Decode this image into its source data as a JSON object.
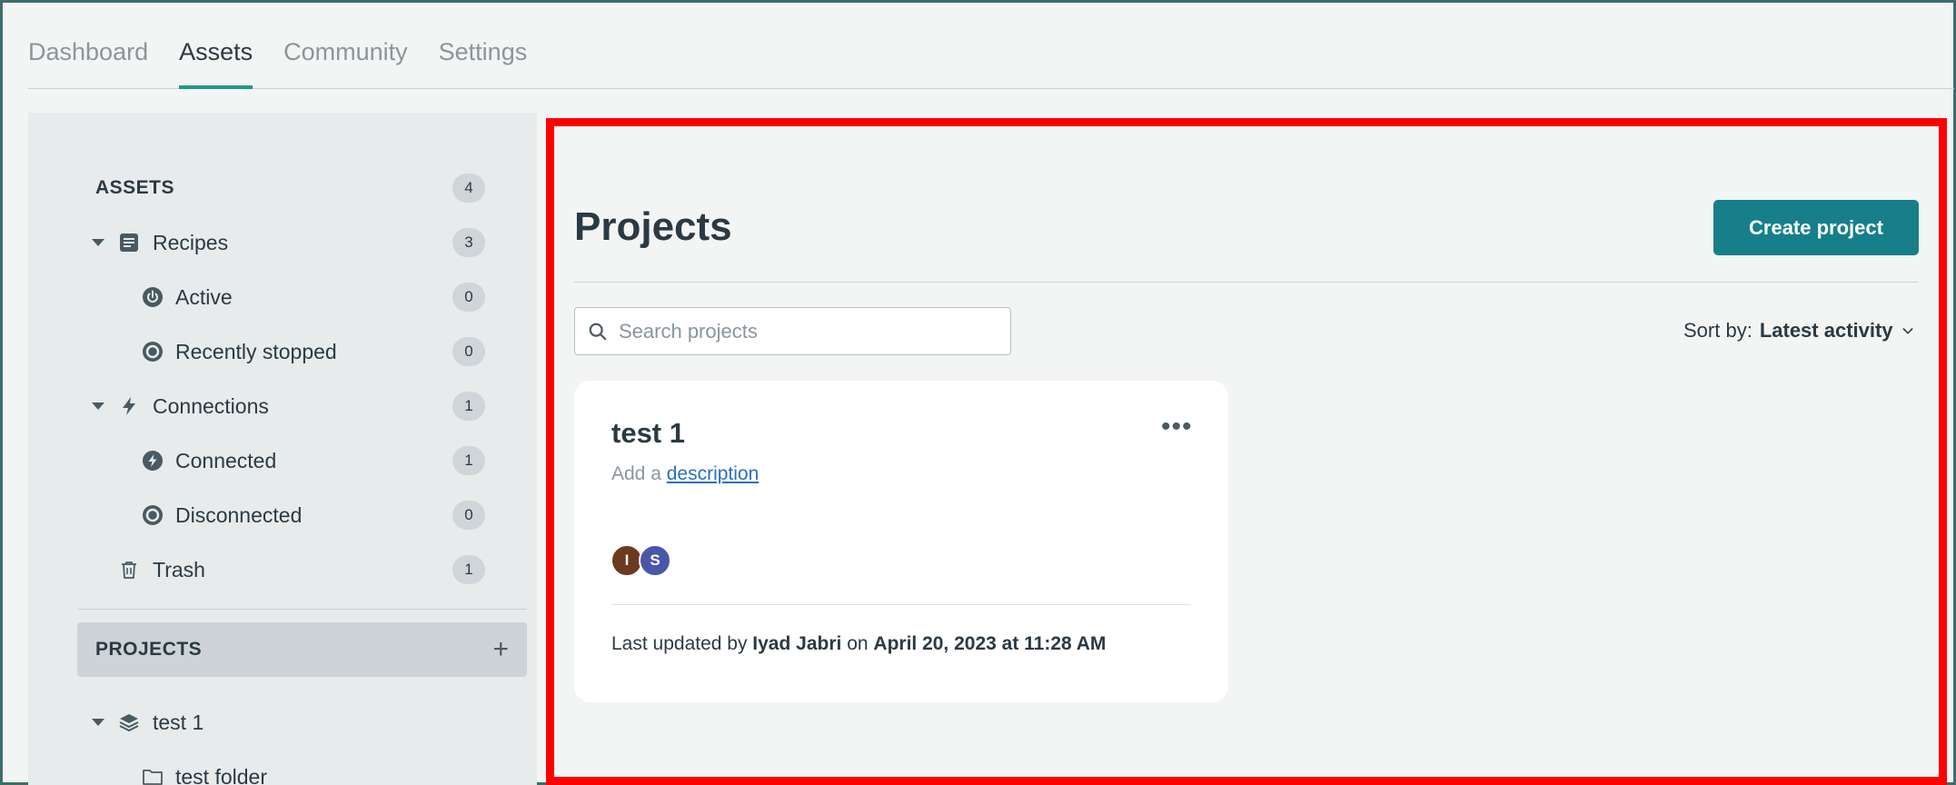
{
  "nav": {
    "tabs": [
      {
        "label": "Dashboard"
      },
      {
        "label": "Assets"
      },
      {
        "label": "Community"
      },
      {
        "label": "Settings"
      }
    ]
  },
  "sidebar": {
    "assets_title": "ASSETS",
    "assets_count": "4",
    "items": [
      {
        "label": "Recipes",
        "count": "3",
        "icon": "recipe-icon"
      },
      {
        "label": "Active",
        "count": "0",
        "icon": "power-icon"
      },
      {
        "label": "Recently stopped",
        "count": "0",
        "icon": "stopped-icon"
      },
      {
        "label": "Connections",
        "count": "1",
        "icon": "lightning-icon"
      },
      {
        "label": "Connected",
        "count": "1",
        "icon": "connected-icon"
      },
      {
        "label": "Disconnected",
        "count": "0",
        "icon": "disconnected-icon"
      },
      {
        "label": "Trash",
        "count": "1",
        "icon": "trash-icon"
      }
    ],
    "projects_title": "PROJECTS",
    "project_tree": [
      {
        "label": "test 1",
        "icon": "layers-icon"
      },
      {
        "label": "test folder",
        "icon": "folder-icon"
      }
    ]
  },
  "main": {
    "title": "Projects",
    "create_label": "Create project",
    "search_placeholder": "Search projects",
    "sort_prefix": "Sort by:",
    "sort_value": "Latest activity",
    "card": {
      "title": "test 1",
      "desc_prefix": "Add a",
      "desc_link": "description",
      "avatars": [
        {
          "initial": "I",
          "color": "#6b3a1f"
        },
        {
          "initial": "S",
          "color": "#4b56a8"
        }
      ],
      "footer_prefix": "Last updated by",
      "footer_user": "Iyad Jabri",
      "footer_mid": "on",
      "footer_date": "April 20, 2023 at 11:28 AM"
    }
  },
  "colors": {
    "accent": "#1f9a8a",
    "button": "#167f8a",
    "highlight": "#ff0000",
    "link": "#2a6fc0"
  }
}
